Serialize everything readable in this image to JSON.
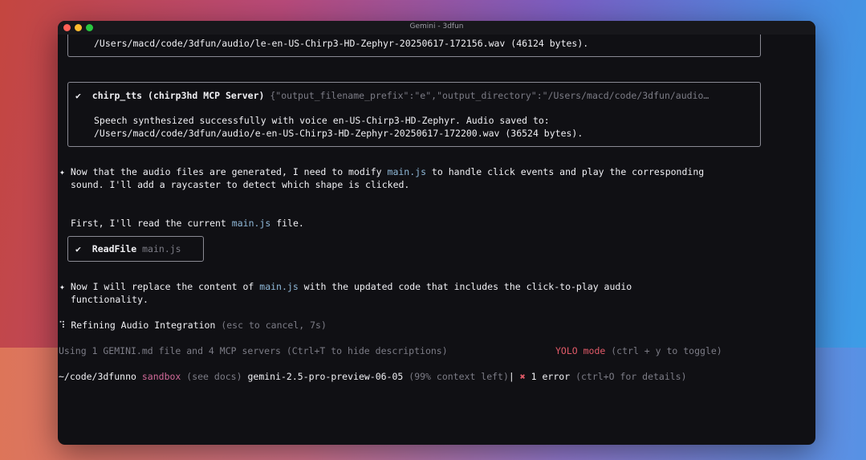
{
  "window": {
    "title": "Gemini - 3dfun"
  },
  "terminal": {
    "box1_line": "/Users/macd/code/3dfun/audio/le-en-US-Chirp3-HD-Zephyr-20250617-172156.wav (46124 bytes).",
    "box2": {
      "check": "✔",
      "tool": "chirp_tts (chirp3hd MCP Server)",
      "args": "{\"output_filename_prefix\":\"e\",\"output_directory\":\"/Users/macd/code/3dfun/audio…",
      "result_line1": "Speech synthesized successfully with voice en-US-Chirp3-HD-Zephyr. Audio saved to:",
      "result_line2": "/Users/macd/code/3dfun/audio/e-en-US-Chirp3-HD-Zephyr-20250617-172200.wav (36524 bytes)."
    },
    "msg1": {
      "bullet": "✦",
      "a": "Now that the audio files are generated, I need to modify ",
      "file": "main.js",
      "b": " to handle click events and play the corresponding",
      "line2": "sound. I'll add a raycaster to detect which shape is clicked."
    },
    "msg2": {
      "a": "First, I'll read the current ",
      "file": "main.js",
      "b": " file."
    },
    "box3": {
      "check": "✔",
      "tool": "ReadFile",
      "arg": "main.js"
    },
    "msg3": {
      "bullet": "✦",
      "a": "Now I will replace the content of ",
      "file": "main.js",
      "b": " with the updated code that includes the click-to-play audio",
      "line2": "functionality."
    },
    "spinner": {
      "icon": "⠹",
      "label": "Refining Audio Integration",
      "hint": "(esc to cancel, 7s)"
    },
    "context": {
      "left": "Using 1 GEMINI.md file and 4 MCP servers (Ctrl+T to hide descriptions)",
      "yolo": "YOLO mode",
      "yolo_hint": "(ctrl + y to toggle)"
    },
    "footer": {
      "path": "~/code/3dfunno",
      "sandbox": "sandbox",
      "sandbox_hint": "(see docs)",
      "model": "gemini-2.5-pro-preview-06-05",
      "context_left": "(99% context left)",
      "sep": "|",
      "error_icon": "✖",
      "error": "1 error",
      "error_hint": "(ctrl+O for details)"
    }
  }
}
